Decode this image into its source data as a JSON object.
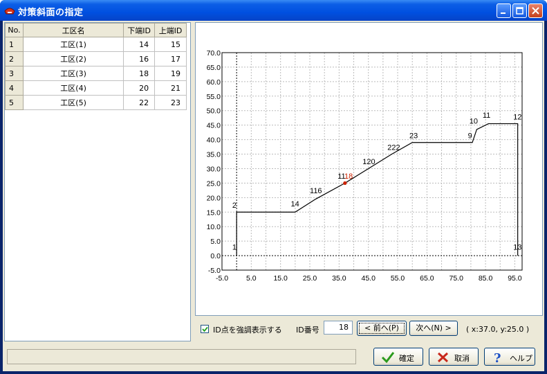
{
  "window": {
    "title": "対策斜面の指定"
  },
  "table": {
    "headers": [
      "No.",
      "工区名",
      "下端ID",
      "上端ID"
    ],
    "rows": [
      {
        "no": "1",
        "name": "工区(1)",
        "lower": "14",
        "upper": "15"
      },
      {
        "no": "2",
        "name": "工区(2)",
        "lower": "16",
        "upper": "17"
      },
      {
        "no": "3",
        "name": "工区(3)",
        "lower": "18",
        "upper": "19"
      },
      {
        "no": "4",
        "name": "工区(4)",
        "lower": "20",
        "upper": "21"
      },
      {
        "no": "5",
        "name": "工区(5)",
        "lower": "22",
        "upper": "23"
      }
    ]
  },
  "chart_data": {
    "type": "line",
    "xlim": [
      -5.0,
      97.5
    ],
    "ylim": [
      -5.0,
      70.0
    ],
    "x_ticks": [
      "-5.0",
      "5.0",
      "15.0",
      "25.0",
      "35.0",
      "45.0",
      "55.0",
      "65.0",
      "75.0",
      "85.0",
      "95.0"
    ],
    "y_ticks": [
      "70.0",
      "65.0",
      "60.0",
      "55.0",
      "50.0",
      "45.0",
      "40.0",
      "35.0",
      "30.0",
      "25.0",
      "20.0",
      "15.0",
      "10.0",
      "5.0",
      "0.0",
      "-5.0"
    ],
    "grid": true,
    "profile": [
      [
        0,
        0
      ],
      [
        0,
        15
      ],
      [
        20,
        15
      ],
      [
        27,
        19.5
      ],
      [
        37,
        25
      ],
      [
        45,
        30
      ],
      [
        53,
        35
      ],
      [
        60,
        39
      ],
      [
        80.5,
        39
      ],
      [
        82,
        43.5
      ],
      [
        86,
        45.5
      ],
      [
        96,
        45.5
      ],
      [
        96,
        0
      ]
    ],
    "point_labels": [
      {
        "text": "1",
        "x": -1.5,
        "y": 2
      },
      {
        "text": "2",
        "x": -1.5,
        "y": 16.5
      },
      {
        "text": "14",
        "x": 18.5,
        "y": 17
      },
      {
        "text": "116",
        "x": 25,
        "y": 21.5
      },
      {
        "text": "11",
        "x": 34.5,
        "y": 26.5
      },
      {
        "text": "18",
        "x": 36.8,
        "y": 26.5
      },
      {
        "text": "120",
        "x": 43,
        "y": 31.5
      },
      {
        "text": "222",
        "x": 51.5,
        "y": 36.5
      },
      {
        "text": "23",
        "x": 59,
        "y": 40.5
      },
      {
        "text": "9",
        "x": 79,
        "y": 40.5
      },
      {
        "text": "10",
        "x": 79.5,
        "y": 45.5
      },
      {
        "text": "11",
        "x": 84,
        "y": 47.5
      },
      {
        "text": "12",
        "x": 94.5,
        "y": 47
      },
      {
        "text": "13",
        "x": 94.5,
        "y": 2
      }
    ],
    "highlight_point": {
      "x": 37,
      "y": 25
    },
    "highlight_color": "#cc2200"
  },
  "controls": {
    "highlight_checkbox_label": "ID点を強調表示する",
    "highlight_checked": true,
    "id_label": "ID番号",
    "id_value": "18",
    "prev_label": "< 前へ(P)",
    "next_label": "次へ(N) >",
    "coord_text": "( x:37.0, y:25.0 )"
  },
  "buttons": {
    "ok": "確定",
    "cancel": "取消",
    "help": "ヘルプ"
  },
  "status": {
    "text": ""
  }
}
